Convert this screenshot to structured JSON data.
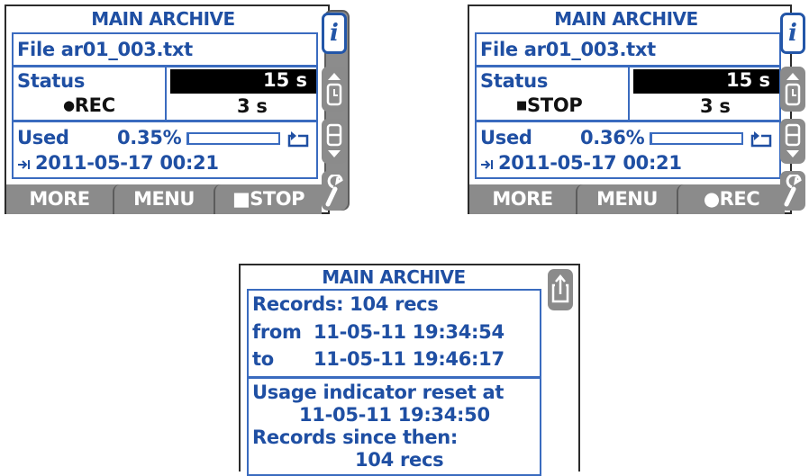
{
  "screens": [
    {
      "title": "MAIN ARCHIVE",
      "file": "File ar01_003.txt",
      "status_label": "Status",
      "state_glyph": "●",
      "state": "REC",
      "interval_main": "15 s",
      "interval_sub": "3 s",
      "used_label": "Used",
      "used_value": "0.35%",
      "usage_progress_pct": 0.35,
      "date": "2011-05-17 00:21",
      "softkeys": [
        "MORE",
        "MENU",
        "■STOP"
      ]
    },
    {
      "title": "MAIN ARCHIVE",
      "file": "File ar01_003.txt",
      "status_label": "Status",
      "state_glyph": "■",
      "state": "STOP",
      "interval_main": "15 s",
      "interval_sub": "3 s",
      "used_label": "Used",
      "used_value": "0.36%",
      "usage_progress_pct": 0.36,
      "date": "2011-05-17 00:21",
      "softkeys": [
        "MORE",
        "MENU",
        "●REC"
      ]
    }
  ],
  "info": {
    "title": "MAIN ARCHIVE",
    "records_line": "Records: 104 recs",
    "from_label": "from",
    "from_value": "11-05-11 19:34:54",
    "to_label": "to",
    "to_value": "11-05-11 19:46:17",
    "reset_line": "Usage indicator reset at",
    "reset_value": "11-05-11 19:34:50",
    "since_label": "Records since then:",
    "since_value": "104 recs"
  },
  "icons": {
    "info": "info-icon",
    "clock": "clock-icon",
    "archive": "archive-icon",
    "settings": "wrench-icon",
    "return": "return-icon",
    "export": "export-icon",
    "arrow": "arrow-to-icon",
    "cycle": "cycle-icon"
  },
  "colors": {
    "accent": "#1f4fa3",
    "frame": "#3a6bbf",
    "gray": "#8b8b8b"
  }
}
